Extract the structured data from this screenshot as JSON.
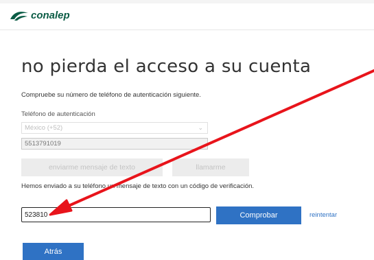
{
  "header": {
    "logo_text": "conalep"
  },
  "page": {
    "title": "no pierda el acceso a su cuenta",
    "intro": "Compruebe su número de teléfono de autenticación siguiente.",
    "phone_label": "Teléfono de autenticación",
    "country_select_value": "México (+52)",
    "phone_value": "5513791019",
    "send_text_button": "enviarme mensaje de texto",
    "call_button": "llamarme",
    "sent_message": "Hemos enviado a su teléfono un mensaje de texto con un código de verificación.",
    "code_value": "523810",
    "verify_button": "Comprobar",
    "retry_link": "reintentar",
    "back_button": "Atrás"
  },
  "colors": {
    "brand_green": "#0b5c45",
    "primary_blue": "#2f72c4",
    "annotation_red": "#e8141b"
  }
}
